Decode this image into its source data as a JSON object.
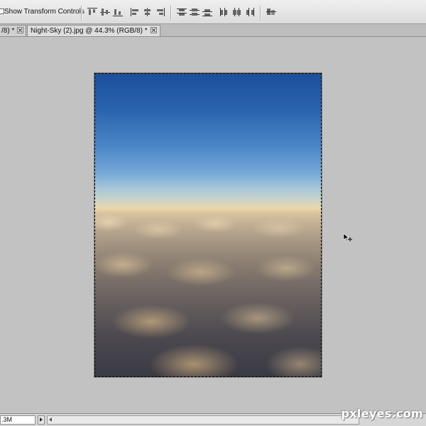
{
  "options_bar": {
    "show_transform_controls_label": "Show Transform Controls",
    "show_transform_controls_checked": false,
    "align_icons": [
      "align-top-edges-icon",
      "align-vertical-centers-icon",
      "align-bottom-edges-icon",
      "align-left-edges-icon",
      "align-horizontal-centers-icon",
      "align-right-edges-icon"
    ],
    "distribute_icons": [
      "distribute-top-edges-icon",
      "distribute-vertical-centers-icon",
      "distribute-bottom-edges-icon",
      "distribute-left-edges-icon",
      "distribute-horizontal-centers-icon",
      "distribute-right-edges-icon"
    ],
    "auto_align_icon": "auto-align-layers-icon"
  },
  "tabs": [
    {
      "label": "/8) *",
      "active": false
    },
    {
      "label": "Night-Sky (2).jpg @ 44.3% (RGB/8) *",
      "active": true
    }
  ],
  "statusbar": {
    "zoom_value": ".3M"
  },
  "watermark": "pxleyes.com",
  "colors": {
    "workspace": "#c2c2c2",
    "sky_top": "#1b4f9c",
    "horizon": "#ead7a8"
  }
}
